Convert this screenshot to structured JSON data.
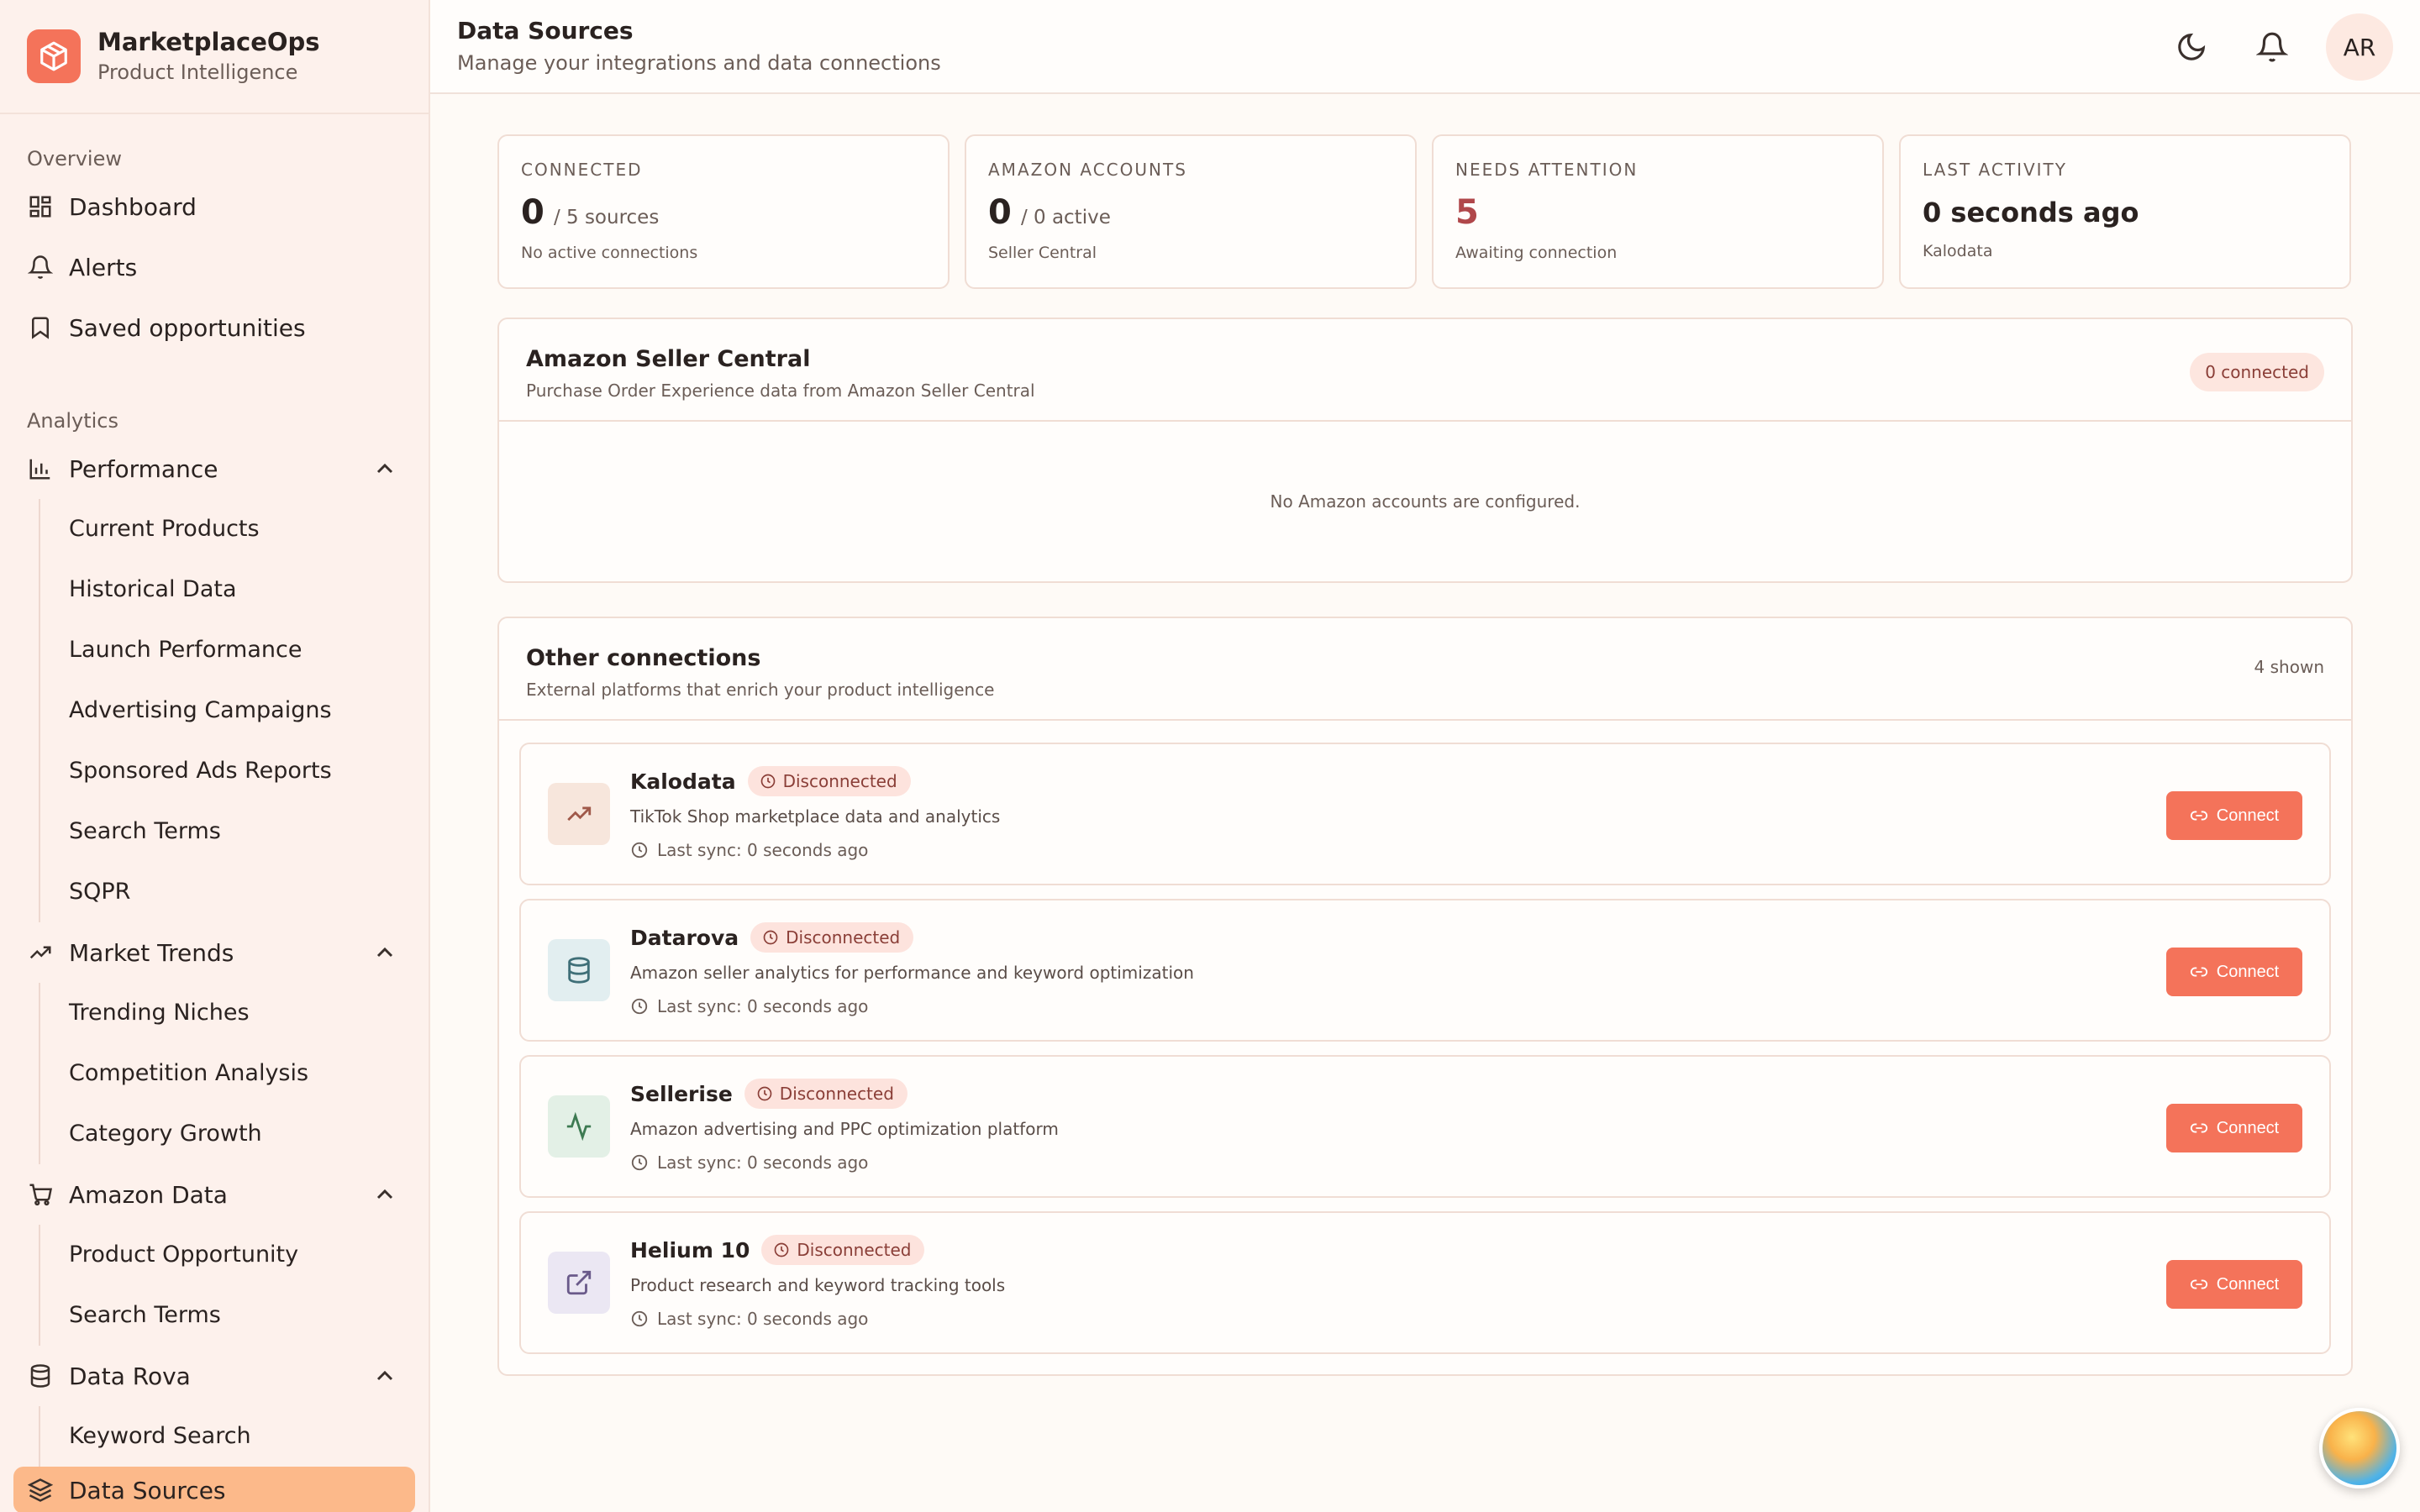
{
  "brand": {
    "name": "MarketplaceOps",
    "subtitle": "Product Intelligence"
  },
  "sidebar": {
    "overview_label": "Overview",
    "dashboard": "Dashboard",
    "alerts": "Alerts",
    "saved": "Saved opportunities",
    "analytics_label": "Analytics",
    "performance": {
      "label": "Performance",
      "items": [
        "Current Products",
        "Historical Data",
        "Launch Performance",
        "Advertising Campaigns",
        "Sponsored Ads Reports",
        "Search Terms",
        "SQPR"
      ]
    },
    "market_trends": {
      "label": "Market Trends",
      "items": [
        "Trending Niches",
        "Competition Analysis",
        "Category Growth"
      ]
    },
    "amazon_data": {
      "label": "Amazon Data",
      "items": [
        "Product Opportunity",
        "Search Terms"
      ]
    },
    "data_rova": {
      "label": "Data Rova",
      "items": [
        "Keyword Search"
      ]
    },
    "active_item": "Data Sources"
  },
  "header": {
    "title": "Data Sources",
    "subtitle": "Manage your integrations and data connections",
    "avatar_initials": "AR"
  },
  "stats": [
    {
      "label": "CONNECTED",
      "value": "0",
      "unit": "/ 5 sources",
      "note": "No active connections"
    },
    {
      "label": "AMAZON ACCOUNTS",
      "value": "0",
      "unit": "/ 0 active",
      "note": "Seller Central"
    },
    {
      "label": "NEEDS ATTENTION",
      "value": "5",
      "unit": "",
      "note": "Awaiting connection"
    },
    {
      "label": "LAST ACTIVITY",
      "value": "0 seconds ago",
      "unit": "",
      "note": "Kalodata"
    }
  ],
  "amazon_panel": {
    "title": "Amazon Seller Central",
    "subtitle": "Purchase Order Experience data from Amazon Seller Central",
    "badge": "0 connected",
    "empty": "No Amazon accounts are configured."
  },
  "other_panel": {
    "title": "Other connections",
    "subtitle": "External platforms that enrich your product intelligence",
    "count": "4 shown",
    "status_label": "Disconnected",
    "connect_label": "Connect",
    "connections": [
      {
        "name": "Kalodata",
        "desc": "TikTok Shop marketplace data and analytics",
        "sync": "Last sync: 0 seconds ago",
        "icon": "trending-up-icon"
      },
      {
        "name": "Datarova",
        "desc": "Amazon seller analytics for performance and keyword optimization",
        "sync": "Last sync: 0 seconds ago",
        "icon": "database-icon"
      },
      {
        "name": "Sellerise",
        "desc": "Amazon advertising and PPC optimization platform",
        "sync": "Last sync: 0 seconds ago",
        "icon": "activity-icon"
      },
      {
        "name": "Helium 10",
        "desc": "Product research and keyword tracking tools",
        "sync": "Last sync: 0 seconds ago",
        "icon": "external-link-icon"
      }
    ]
  },
  "colors": {
    "accent": "#f4735a",
    "active_nav": "#fcb98a",
    "badge_bg": "#fde3dd",
    "warn": "#b0474a"
  }
}
